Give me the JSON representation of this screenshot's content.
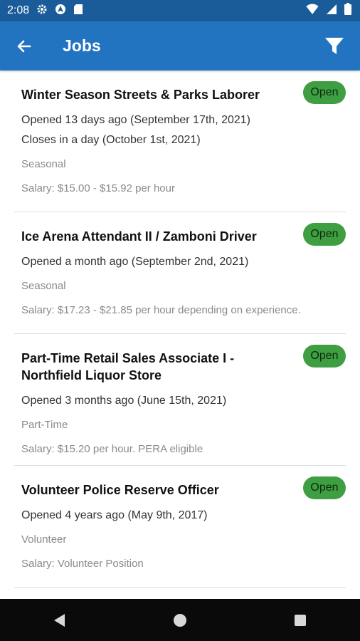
{
  "status_bar": {
    "time": "2:08"
  },
  "app_bar": {
    "title": "Jobs"
  },
  "jobs": [
    {
      "title": "Winter Season Streets & Parks Laborer",
      "status": "Open",
      "opened": "Opened 13 days ago (September 17th, 2021)",
      "closes": "Closes in a day (October 1st, 2021)",
      "type": "Seasonal",
      "salary": "Salary: $15.00 - $15.92 per hour"
    },
    {
      "title": "Ice Arena Attendant II / Zamboni Driver",
      "status": "Open",
      "opened": "Opened a month ago (September 2nd, 2021)",
      "type": "Seasonal",
      "salary": "Salary: $17.23 - $21.85 per hour depending on experience."
    },
    {
      "title": "Part-Time Retail Sales Associate I - Northfield Liquor Store",
      "status": "Open",
      "opened": "Opened 3 months ago (June 15th, 2021)",
      "type": "Part-Time",
      "salary": "Salary: $15.20 per hour. PERA eligible"
    },
    {
      "title": "Volunteer Police Reserve Officer",
      "status": "Open",
      "opened": "Opened 4 years ago (May 9th, 2017)",
      "type": "Volunteer",
      "salary": "Salary: Volunteer Position"
    }
  ],
  "colors": {
    "status_bar": "#1a5c9a",
    "app_bar": "#2274c1",
    "badge": "#3e9e41",
    "nav_bar": "#0a0a0a"
  },
  "icons": {
    "status_left": [
      "settings-icon",
      "location-icon",
      "sd-card-icon"
    ],
    "status_right": [
      "wifi-icon",
      "signal-icon",
      "battery-icon"
    ],
    "app_bar": [
      "back-arrow-icon",
      "filter-icon"
    ],
    "nav": [
      "nav-back-icon",
      "nav-home-icon",
      "nav-recents-icon"
    ]
  }
}
